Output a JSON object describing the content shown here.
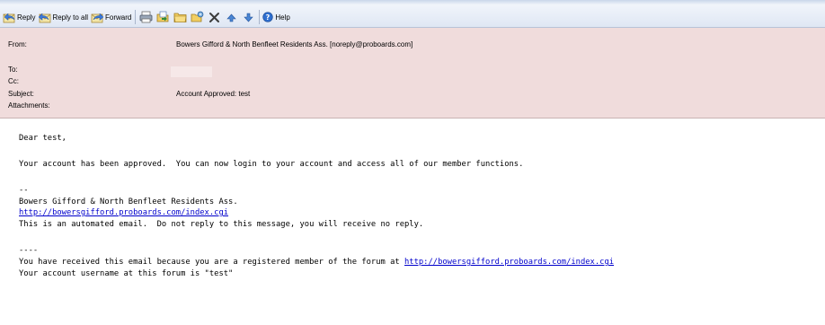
{
  "toolbar": {
    "reply_label": "Reply",
    "reply_all_label": "Reply to all",
    "forward_label": "Forward",
    "help_label": "Help"
  },
  "header": {
    "from_label": "From:",
    "from_value": "Bowers Gifford & North Benfleet Residents Ass. [noreply@proboards.com]",
    "to_label": "To:",
    "cc_label": "Cc:",
    "subject_label": "Subject:",
    "subject_value": "Account Approved: test",
    "attachments_label": "Attachments:"
  },
  "body": {
    "greeting": "Dear test,",
    "approved": "Your account has been approved.  You can now login to your account and access all of our member functions.",
    "sig_dashes": "--",
    "sig_name": "Bowers Gifford & North Benfleet Residents Ass.",
    "sig_link": "http://bowersgifford.proboards.com/index.cgi",
    "automated": "This is an automated email.  Do not reply to this message, you will receive no reply.",
    "footer_dashes": "----",
    "registered_prefix": "You have received this email because you are a registered member of the forum at ",
    "registered_link": "http://bowersgifford.proboards.com/index.cgi",
    "username_line": "Your account username at this forum is \"test\""
  }
}
